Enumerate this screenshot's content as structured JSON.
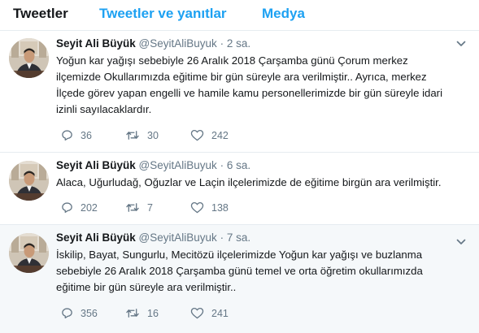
{
  "tabs": [
    {
      "label": "Tweetler"
    },
    {
      "label": "Tweetler ve yanıtlar"
    },
    {
      "label": "Medya"
    }
  ],
  "colors": {
    "accent": "#1da1f2",
    "text": "#14171a",
    "muted": "#657786",
    "border": "#e6ecf0",
    "highlight_bg": "#f5f8fa"
  },
  "tweets": [
    {
      "name": "Seyit Ali Büyük",
      "handle": "@SeyitAliBuyuk",
      "dot": "·",
      "time": "2 sa.",
      "lines": [
        "Yoğun kar yağışı sebebiyle 26 Aralık 2018 Çarşamba günü Çorum merkez",
        "ilçemizde  Okullarımızda eğitime bir gün süreyle ara verilmiştir.. Ayrıca, merkez",
        "İlçede görev yapan engelli ve hamile  kamu personellerimizde bir gün süreyle idari",
        "izinli sayılacaklardır."
      ],
      "replies": "36",
      "retweets": "30",
      "likes": "242"
    },
    {
      "name": "Seyit Ali Büyük",
      "handle": "@SeyitAliBuyuk",
      "dot": "·",
      "time": "6 sa.",
      "lines": [
        "Alaca, Uğurludağ, Oğuzlar ve Laçin ilçelerimizde de eğitime birgün ara verilmiştir."
      ],
      "replies": "202",
      "retweets": "7",
      "likes": "138"
    },
    {
      "name": "Seyit Ali Büyük",
      "handle": "@SeyitAliBuyuk",
      "dot": "·",
      "time": "7 sa.",
      "lines": [
        "İskilip, Bayat, Sungurlu, Mecitözü ilçelerimizde Yoğun kar yağışı ve buzlanma",
        "sebebiyle 26 Aralık 2018 Çarşamba günü temel ve orta öğretim okullarımızda",
        "eğitime bir gün süreyle ara verilmiştir.."
      ],
      "replies": "356",
      "retweets": "16",
      "likes": "241"
    }
  ],
  "icons": {
    "reply": "reply-icon",
    "retweet": "retweet-icon",
    "like": "heart-icon",
    "caret": "chevron-down-icon",
    "avatar": "avatar"
  }
}
